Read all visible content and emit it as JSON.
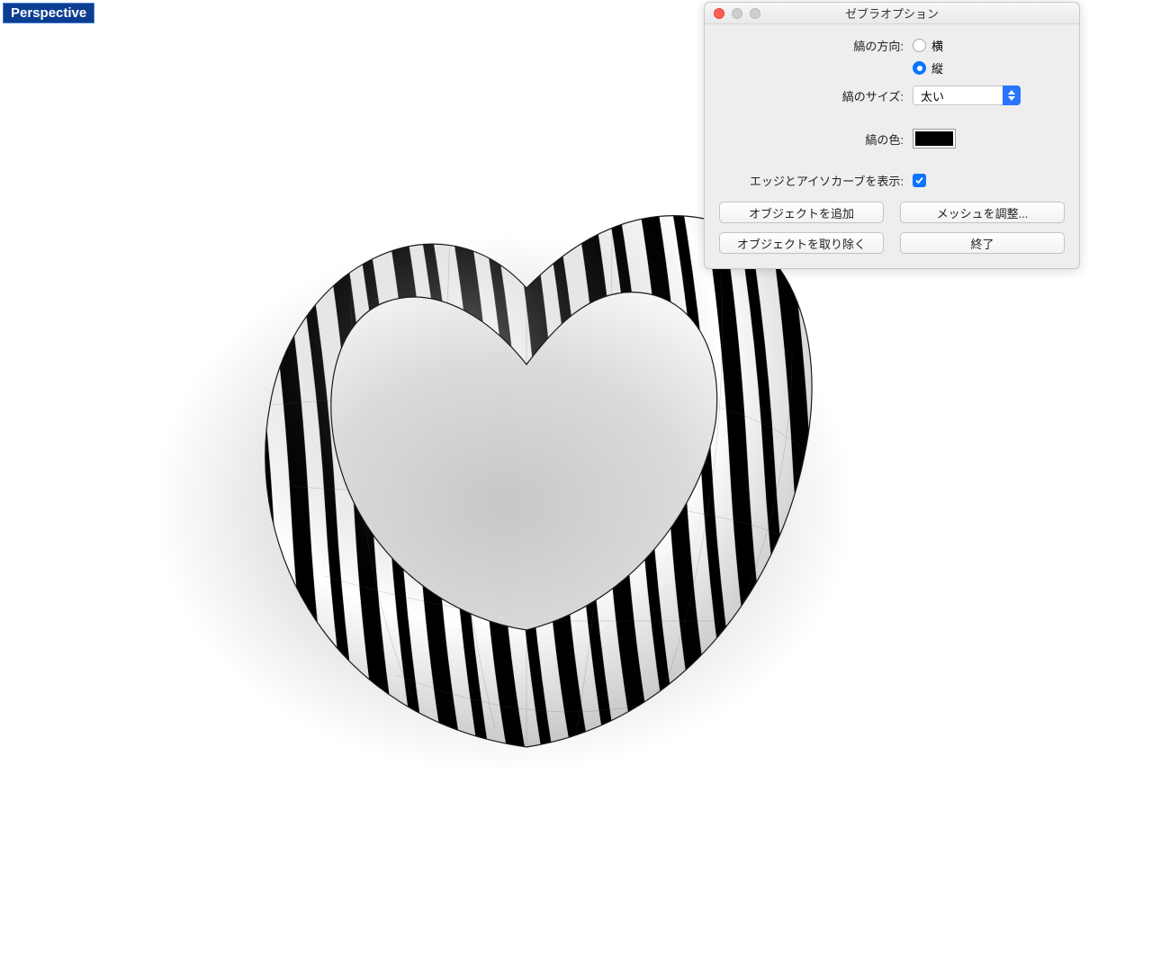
{
  "viewport": {
    "label": "Perspective"
  },
  "dialog": {
    "title": "ゼブラオプション",
    "labels": {
      "direction": "縞の方向:",
      "size": "縞のサイズ:",
      "color": "縞の色:",
      "show_edges": "エッジとアイソカーブを表示:"
    },
    "direction": {
      "option_horizontal": "横",
      "option_vertical": "縦",
      "selected": "vertical"
    },
    "size": {
      "value": "太い"
    },
    "color": {
      "value": "#000000"
    },
    "show_edges_isocurves": true,
    "buttons": {
      "add_object": "オブジェクトを追加",
      "adjust_mesh": "メッシュを調整...",
      "remove_object": "オブジェクトを取り除く",
      "finish": "終了"
    }
  }
}
